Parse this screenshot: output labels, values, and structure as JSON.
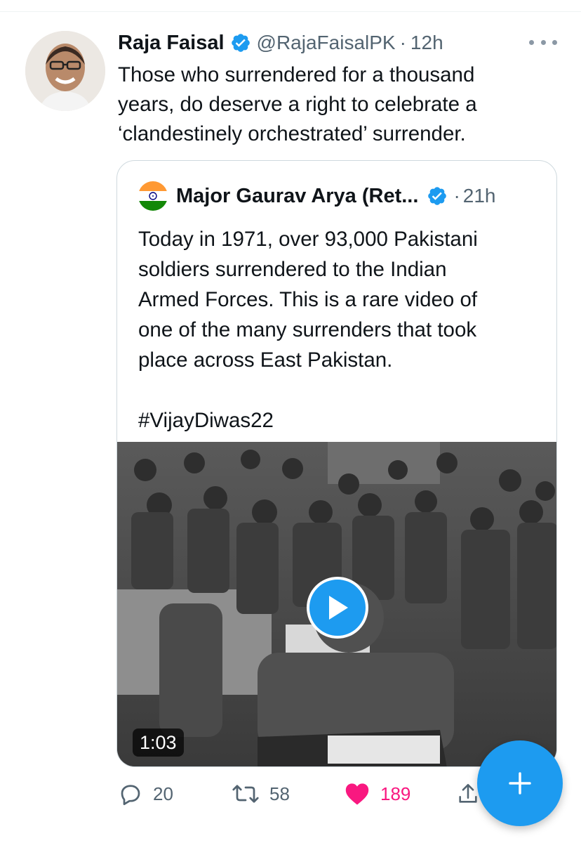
{
  "tweet": {
    "author_name": "Raja Faisal",
    "handle": "@RajaFaisalPK",
    "separator": "·",
    "time": "12h",
    "text": "Those who surrendered for a thousand\nyears, do deserve a right to celebrate a\n‘clandestinely orchestrated’ surrender."
  },
  "quoted_tweet": {
    "author_name": "Major Gaurav Arya (Ret...",
    "separator": "·",
    "time": "21h",
    "text": "Today in 1971, over 93,000 Pakistani\nsoldiers surrendered to the Indian\nArmed Forces. This is a rare video of\none of the many surrenders that took\nplace across East Pakistan.\n\n#VijayDiwas22",
    "video_duration": "1:03"
  },
  "actions": {
    "replies": "20",
    "retweets": "58",
    "likes": "189"
  },
  "icons": {
    "verified": "verified-badge-icon",
    "more": "more-dots-icon",
    "reply": "reply-icon",
    "retweet": "retweet-icon",
    "like": "heart-icon",
    "share": "share-icon",
    "play": "play-icon",
    "compose": "plus-icon"
  },
  "colors": {
    "accent": "#1d9bf0",
    "like": "#f91880",
    "muted": "#536471",
    "text": "#0f1419"
  }
}
